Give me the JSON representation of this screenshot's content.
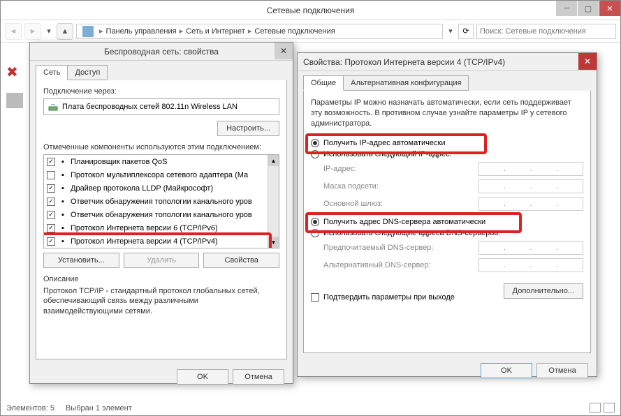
{
  "window": {
    "title": "Сетевые подключения",
    "search_placeholder": "Поиск: Сетевые подключения",
    "breadcrumb": [
      "Панель управления",
      "Сеть и Интернет",
      "Сетевые подключения"
    ]
  },
  "status": {
    "count": "Элементов: 5",
    "selected": "Выбран 1 элемент"
  },
  "wirelessDlg": {
    "title": "Беспроводная сеть: свойства",
    "tabs": {
      "network": "Сеть",
      "access": "Доступ"
    },
    "connect_via_label": "Подключение через:",
    "adapter": "Плата беспроводных сетей 802.11n Wireless LAN",
    "configure_btn": "Настроить...",
    "components_label": "Отмеченные компоненты используются этим подключением:",
    "components": [
      {
        "checked": true,
        "icon": "qos",
        "label": "Планировщик пакетов QoS"
      },
      {
        "checked": false,
        "icon": "mux",
        "label": "Протокол мультиплексора сетевого адаптера (Ма"
      },
      {
        "checked": true,
        "icon": "lldp",
        "label": "Драйвер протокола LLDP (Майкрософт)"
      },
      {
        "checked": true,
        "icon": "topo",
        "label": "Ответчик обнаружения топологии канального уров"
      },
      {
        "checked": true,
        "icon": "topo",
        "label": "Ответчик обнаружения топологии канального уров"
      },
      {
        "checked": true,
        "icon": "ipv6",
        "label": "Протокол Интернета версии 6 (TCP/IPv6)"
      },
      {
        "checked": true,
        "icon": "ipv4",
        "label": "Протокол Интернета версии 4 (TCP/IPv4)"
      }
    ],
    "install_btn": "Установить...",
    "remove_btn": "Удалить",
    "properties_btn": "Свойства",
    "desc_label": "Описание",
    "desc_text": "Протокол TCP/IP - стандартный протокол глобальных сетей, обеспечивающий связь между различными взаимодействующими сетями.",
    "ok": "OK",
    "cancel": "Отмена"
  },
  "ipv4Dlg": {
    "title": "Свойства: Протокол Интернета версии 4 (TCP/IPv4)",
    "tabs": {
      "general": "Общие",
      "alt": "Альтернативная конфигурация"
    },
    "blurb": "Параметры IP можно назначать автоматически, если сеть поддерживает эту возможность. В противном случае узнайте параметры IP у сетевого администратора.",
    "ip_auto": "Получить IP-адрес автоматически",
    "ip_manual": "Использовать следующий IP-адрес:",
    "ip_addr_label": "IP-адрес:",
    "mask_label": "Маска подсети:",
    "gateway_label": "Основной шлюз:",
    "dns_auto": "Получить адрес DNS-сервера автоматически",
    "dns_manual": "Использовать следующие адреса DNS-серверов:",
    "dns_pref_label": "Предпочитаемый DNS-сервер:",
    "dns_alt_label": "Альтернативный DNS-сервер:",
    "confirm_exit": "Подтвердить параметры при выходе",
    "advanced_btn": "Дополнительно...",
    "ok": "OK",
    "cancel": "Отмена"
  }
}
